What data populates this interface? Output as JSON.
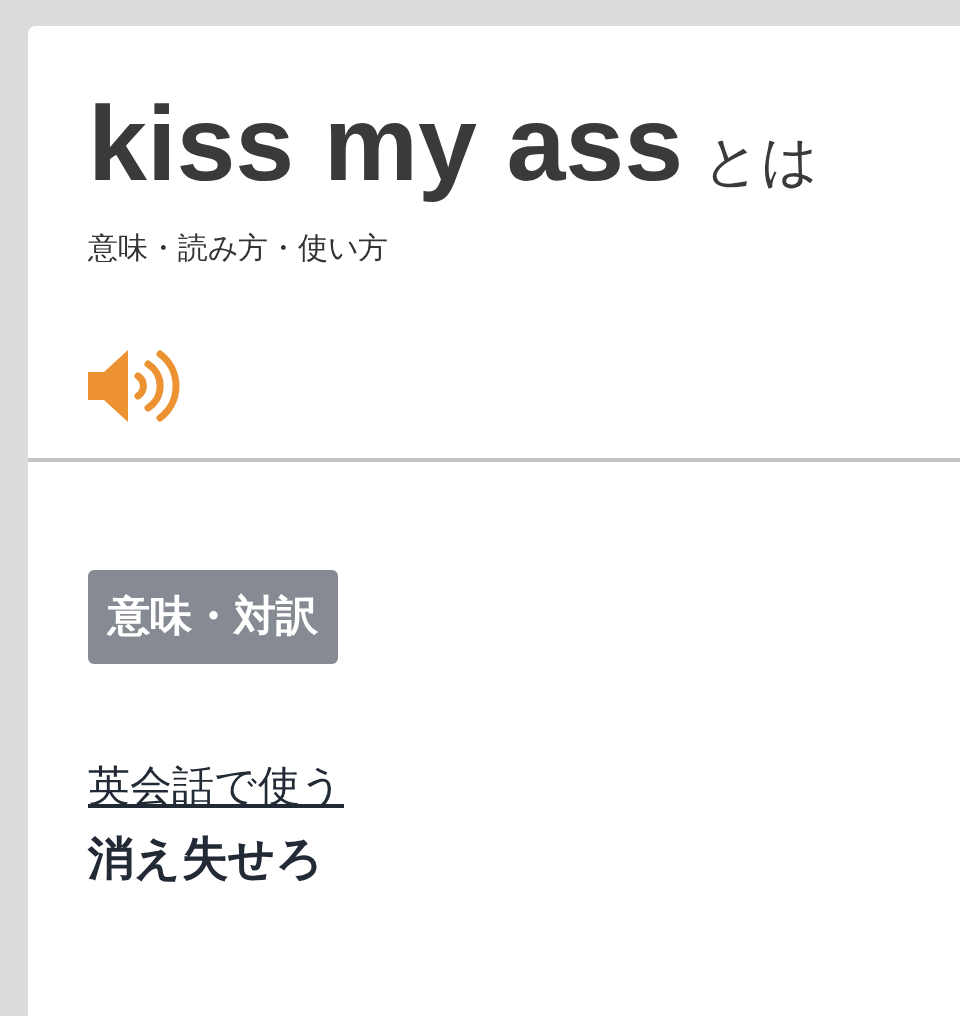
{
  "header": {
    "term": "kiss my ass",
    "suffix": "とは",
    "subtitle": "意味・読み方・使い方"
  },
  "section": {
    "badge": "意味・対訳",
    "link": "英会話で使う",
    "translation": "消え失せろ"
  }
}
